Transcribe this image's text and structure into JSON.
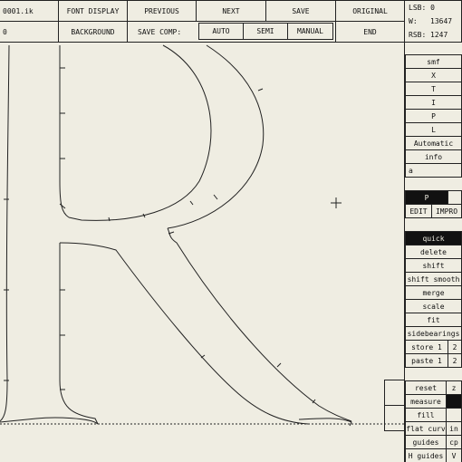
{
  "file": {
    "name": "0001.ik",
    "field2": "0"
  },
  "menu": {
    "row1": [
      "FONT DISPLAY",
      "PREVIOUS",
      "NEXT",
      "SAVE",
      "ORIGINAL"
    ],
    "row2": {
      "background": "BACKGROUND",
      "save_comp": "SAVE COMP:",
      "auto": "AUTO",
      "semi": "SEMI",
      "manual": "MANUAL",
      "end": "END"
    }
  },
  "metrics": {
    "lsb": "LSB: 0",
    "w_label": "W:",
    "w_value": "13647",
    "rsb_label": "RSB:",
    "rsb_value": "1247"
  },
  "panel": {
    "list1": [
      "smf",
      "X",
      "T",
      "I",
      "P",
      "L",
      "Automatic",
      "info"
    ],
    "input_value": "a",
    "mode_p": "P",
    "edit": "EDIT",
    "impro": "IMPRO",
    "quick": "quick",
    "list2": [
      "delete",
      "shift",
      "shift smooth",
      "merge",
      "scale",
      "fit",
      "sidebearings"
    ],
    "store": "store 1",
    "store_b": "2",
    "paste": "paste 1",
    "paste_b": "2",
    "tools": [
      {
        "a": "reset",
        "b": "z"
      },
      {
        "a": "measure",
        "b": ""
      },
      {
        "a": "fill",
        "b": ""
      },
      {
        "a": "flat curv",
        "b": "in"
      },
      {
        "a": "guides",
        "b": "cp"
      },
      {
        "a": "H guides",
        "b": "V"
      }
    ]
  },
  "colors": {
    "background": "#efede2",
    "ink": "#111111"
  }
}
